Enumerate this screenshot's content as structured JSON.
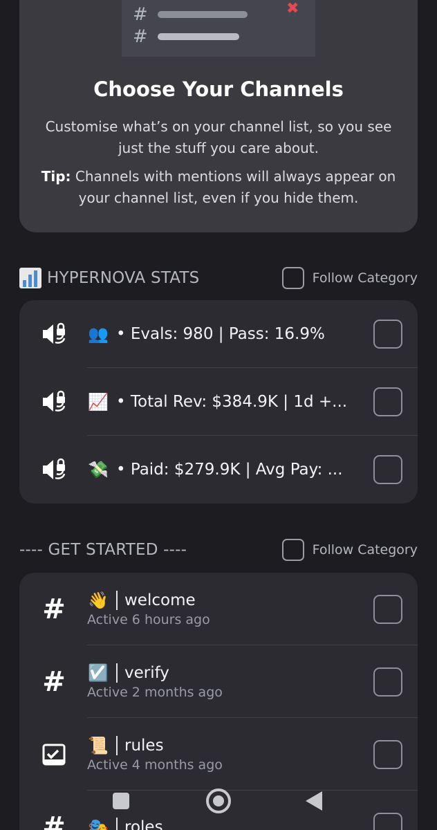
{
  "hero": {
    "title": "Choose Your Channels",
    "description": "Customise what’s on your channel list, so you see just the stuff you care about.",
    "tip_label": "Tip:",
    "tip_text": " Channels with mentions will always appear on your channel list, even if you hide them.",
    "illus_hash": "#"
  },
  "categories": [
    {
      "title": "HYPERNOVA STATS",
      "follow_label": "Follow Category",
      "channels": [
        {
          "icon": "voice-locked-icon",
          "emoji": "👥",
          "name": "• Evals: 980 | Pass: 16.9%"
        },
        {
          "icon": "voice-locked-icon",
          "emoji": "📈",
          "name": "• Total Rev: $384.9K | 1d +..."
        },
        {
          "icon": "voice-locked-icon",
          "emoji": "💸",
          "name": "• Paid: $279.9K | Avg Pay: ..."
        }
      ]
    },
    {
      "title": "---- GET STARTED ----",
      "follow_label": "Follow Category",
      "channels": [
        {
          "icon": "hash-icon",
          "emoji": "👋",
          "name": "welcome",
          "activity": "Active 6 hours ago"
        },
        {
          "icon": "hash-icon",
          "emoji": "☑️",
          "name": "verify",
          "activity": "Active 2 months ago"
        },
        {
          "icon": "rules-icon",
          "emoji": "📜",
          "name": "rules",
          "activity": "Active 4 months ago"
        },
        {
          "icon": "hash-icon",
          "emoji": "🎭",
          "name": "roles"
        }
      ]
    }
  ],
  "hash_symbol": "#"
}
